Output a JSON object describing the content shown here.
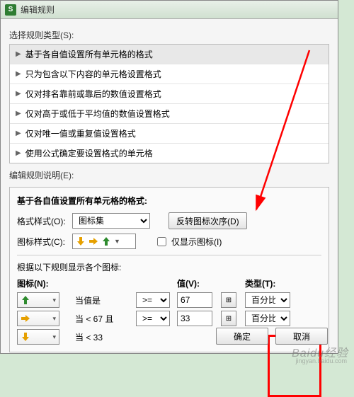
{
  "window": {
    "title": "编辑规则"
  },
  "select_rule_label": "选择规则类型(S):",
  "rules": [
    "基于各自值设置所有单元格的格式",
    "只为包含以下内容的单元格设置格式",
    "仅对排名靠前或靠后的数值设置格式",
    "仅对高于或低于平均值的数值设置格式",
    "仅对唯一值或重复值设置格式",
    "使用公式确定要设置格式的单元格"
  ],
  "edit_desc_label": "编辑规则说明(E):",
  "edit": {
    "heading": "基于各自值设置所有单元格的格式:",
    "format_style_label": "格式样式(O):",
    "format_style_value": "图标集",
    "reverse_btn": "反转图标次序(D)",
    "icon_style_label": "图标样式(C):",
    "show_icon_only": "仅显示图标(I)",
    "rule_hint": "根据以下规则显示各个图标:",
    "cols": {
      "icon": "图标(N):",
      "value": "值(V):",
      "type": "类型(T):"
    },
    "ops": [
      ">=",
      ">="
    ],
    "rows": [
      {
        "icon": "up",
        "cond": "当值是",
        "op": ">=",
        "val": "67",
        "type": "百分比"
      },
      {
        "icon": "right",
        "cond": "当 < 67 且",
        "op": ">=",
        "val": "33",
        "type": "百分比"
      },
      {
        "icon": "down",
        "cond": "当 < 33",
        "op": "",
        "val": "",
        "type": ""
      }
    ]
  },
  "buttons": {
    "ok": "确定",
    "cancel": "取消"
  },
  "watermark": "Baidu经验",
  "watermark_sub": "jingyan.baidu.com"
}
